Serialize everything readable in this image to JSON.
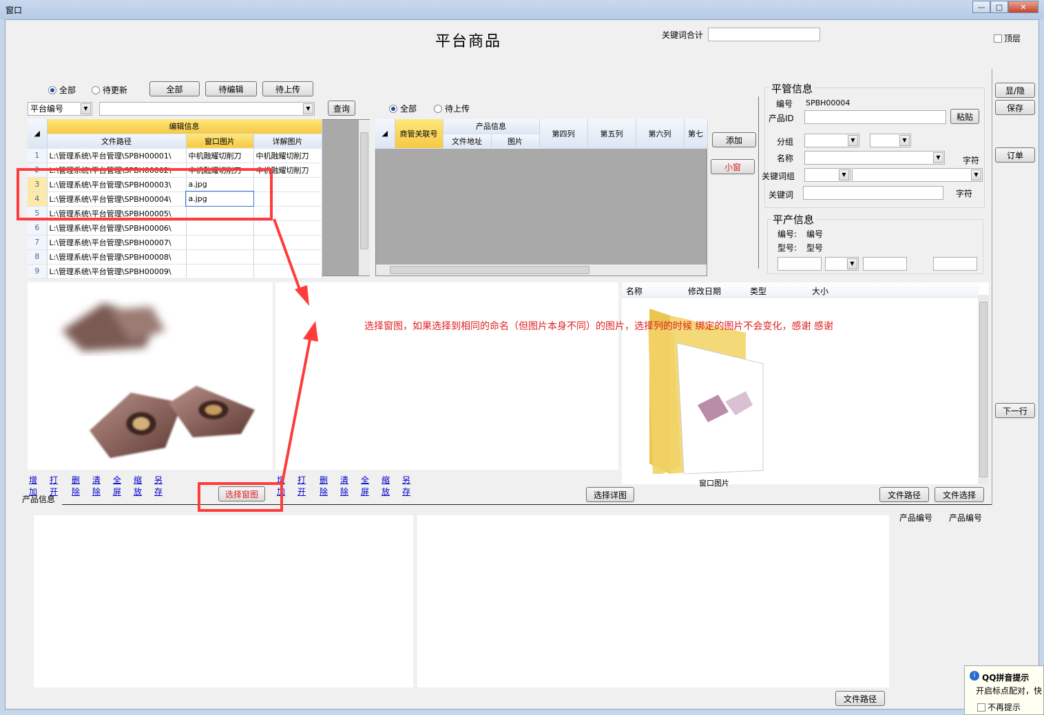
{
  "window": {
    "title": "窗口"
  },
  "header": {
    "page_title": "平台商品",
    "keyword_total_label": "关键词合计",
    "topmost_label": "顶层"
  },
  "right_buttons": {
    "show_hide": "显/隐",
    "save": "保存",
    "order": "订单",
    "next_row": "下一行"
  },
  "left_toolbar": {
    "radio_all": "全部",
    "radio_pending_update": "待更新",
    "btn_all": "全部",
    "btn_pending_edit": "待编辑",
    "btn_pending_upload": "待上传",
    "platform_select": "平台编号",
    "query_btn": "查询"
  },
  "left_grid": {
    "group_header": "编辑信息",
    "columns": [
      "文件路径",
      "窗口图片",
      "详解图片"
    ],
    "rows": [
      {
        "n": "1",
        "path": "L:\\管理系统\\平台管理\\SPBH00001\\",
        "win": "中机融耀切削刀",
        "detail": "中机融耀切削刀"
      },
      {
        "n": "2",
        "path": "L:\\管理系统\\平台管理\\SPBH00002\\",
        "win": "中机融耀切削刀",
        "detail": "中机融耀切削刀"
      },
      {
        "n": "3",
        "path": "L:\\管理系统\\平台管理\\SPBH00003\\",
        "win": "a.jpg",
        "detail": ""
      },
      {
        "n": "4",
        "path": "L:\\管理系统\\平台管理\\SPBH00004\\",
        "win": "a.jpg",
        "detail": ""
      },
      {
        "n": "5",
        "path": "L:\\管理系统\\平台管理\\SPBH00005\\",
        "win": "",
        "detail": ""
      },
      {
        "n": "6",
        "path": "L:\\管理系统\\平台管理\\SPBH00006\\",
        "win": "",
        "detail": ""
      },
      {
        "n": "7",
        "path": "L:\\管理系统\\平台管理\\SPBH00007\\",
        "win": "",
        "detail": ""
      },
      {
        "n": "8",
        "path": "L:\\管理系统\\平台管理\\SPBH00008\\",
        "win": "",
        "detail": ""
      },
      {
        "n": "9",
        "path": "L:\\管理系统\\平台管理\\SPBH00009\\",
        "win": "",
        "detail": ""
      }
    ]
  },
  "mid_toolbar": {
    "radio_all": "全部",
    "radio_pending_upload": "待上传"
  },
  "mid_grid": {
    "col_link": "商管关联号",
    "group_product": "产品信息",
    "col_file_addr": "文件地址",
    "col_image": "图片",
    "col4": "第四列",
    "col5": "第五列",
    "col6": "第六列",
    "col7": "第七"
  },
  "mid_buttons": {
    "add": "添加",
    "small_window": "小窗"
  },
  "platform_info": {
    "legend": "平管信息",
    "code_label": "编号",
    "code_value": "SPBH00004",
    "product_id_label": "产品ID",
    "paste_btn": "粘贴",
    "group_label": "分组",
    "name_label": "名称",
    "chars_label": "字符",
    "keyword_group_label": "关键词组",
    "keyword_label": "关键词",
    "chars_label2": "字符"
  },
  "product_info": {
    "legend": "平产信息",
    "code_label": "编号:",
    "code_value": "编号",
    "model_label": "型号:",
    "model_value": "型号"
  },
  "image_links": [
    "增加",
    "打开",
    "删除",
    "清除",
    "全屏",
    "缩放",
    "另存"
  ],
  "file_list": {
    "columns": [
      "名称",
      "修改日期",
      "类型",
      "大小"
    ],
    "folder_caption": "窗口图片"
  },
  "annotation": "选择窗图，如果选择到相同的命名（但图片本身不同）的图片，选择列的时候 绑定的图片不会变化，感谢 感谢",
  "bottom_buttons": {
    "select_window_image": "选择窗图",
    "select_detail_image": "选择详图",
    "file_path": "文件路径",
    "file_select": "文件选择",
    "file_path2": "文件路径"
  },
  "product_section": {
    "label": "产品信息",
    "code1": "产品编号",
    "code2": "产品编号"
  },
  "qq_popup": {
    "title": "QQ拼音提示",
    "line": "开启标点配对，快",
    "dont_show": "不再提示"
  },
  "colors": {
    "accent_red": "#ff3b3b",
    "header_gold": "#f6c846",
    "link_blue": "#0000cc"
  }
}
